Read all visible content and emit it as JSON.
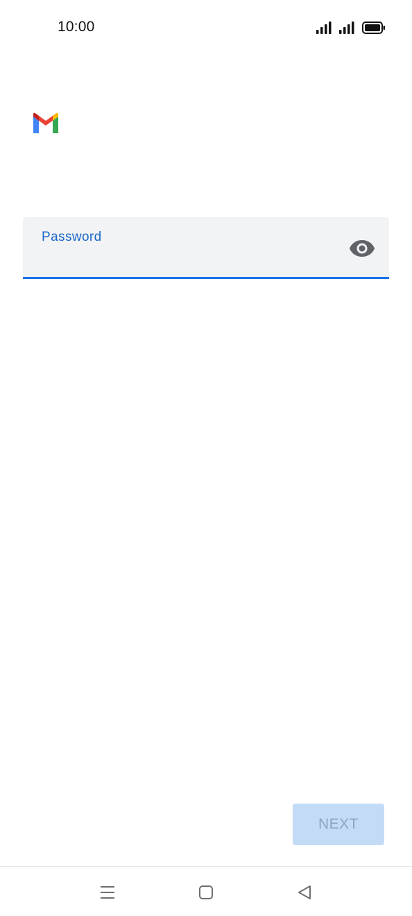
{
  "status_bar": {
    "time": "10:00",
    "icons": [
      "signal-icon",
      "signal-icon",
      "battery-icon"
    ]
  },
  "app": {
    "logo": "gmail-logo-icon"
  },
  "password_field": {
    "label": "Password",
    "value": "",
    "visibility_icon": "eye-icon",
    "focus_color": "#1a73e8"
  },
  "actions": {
    "next_label": "NEXT",
    "next_enabled": false
  },
  "nav_bar": {
    "buttons": [
      "menu-icon",
      "home-icon",
      "back-icon"
    ]
  }
}
